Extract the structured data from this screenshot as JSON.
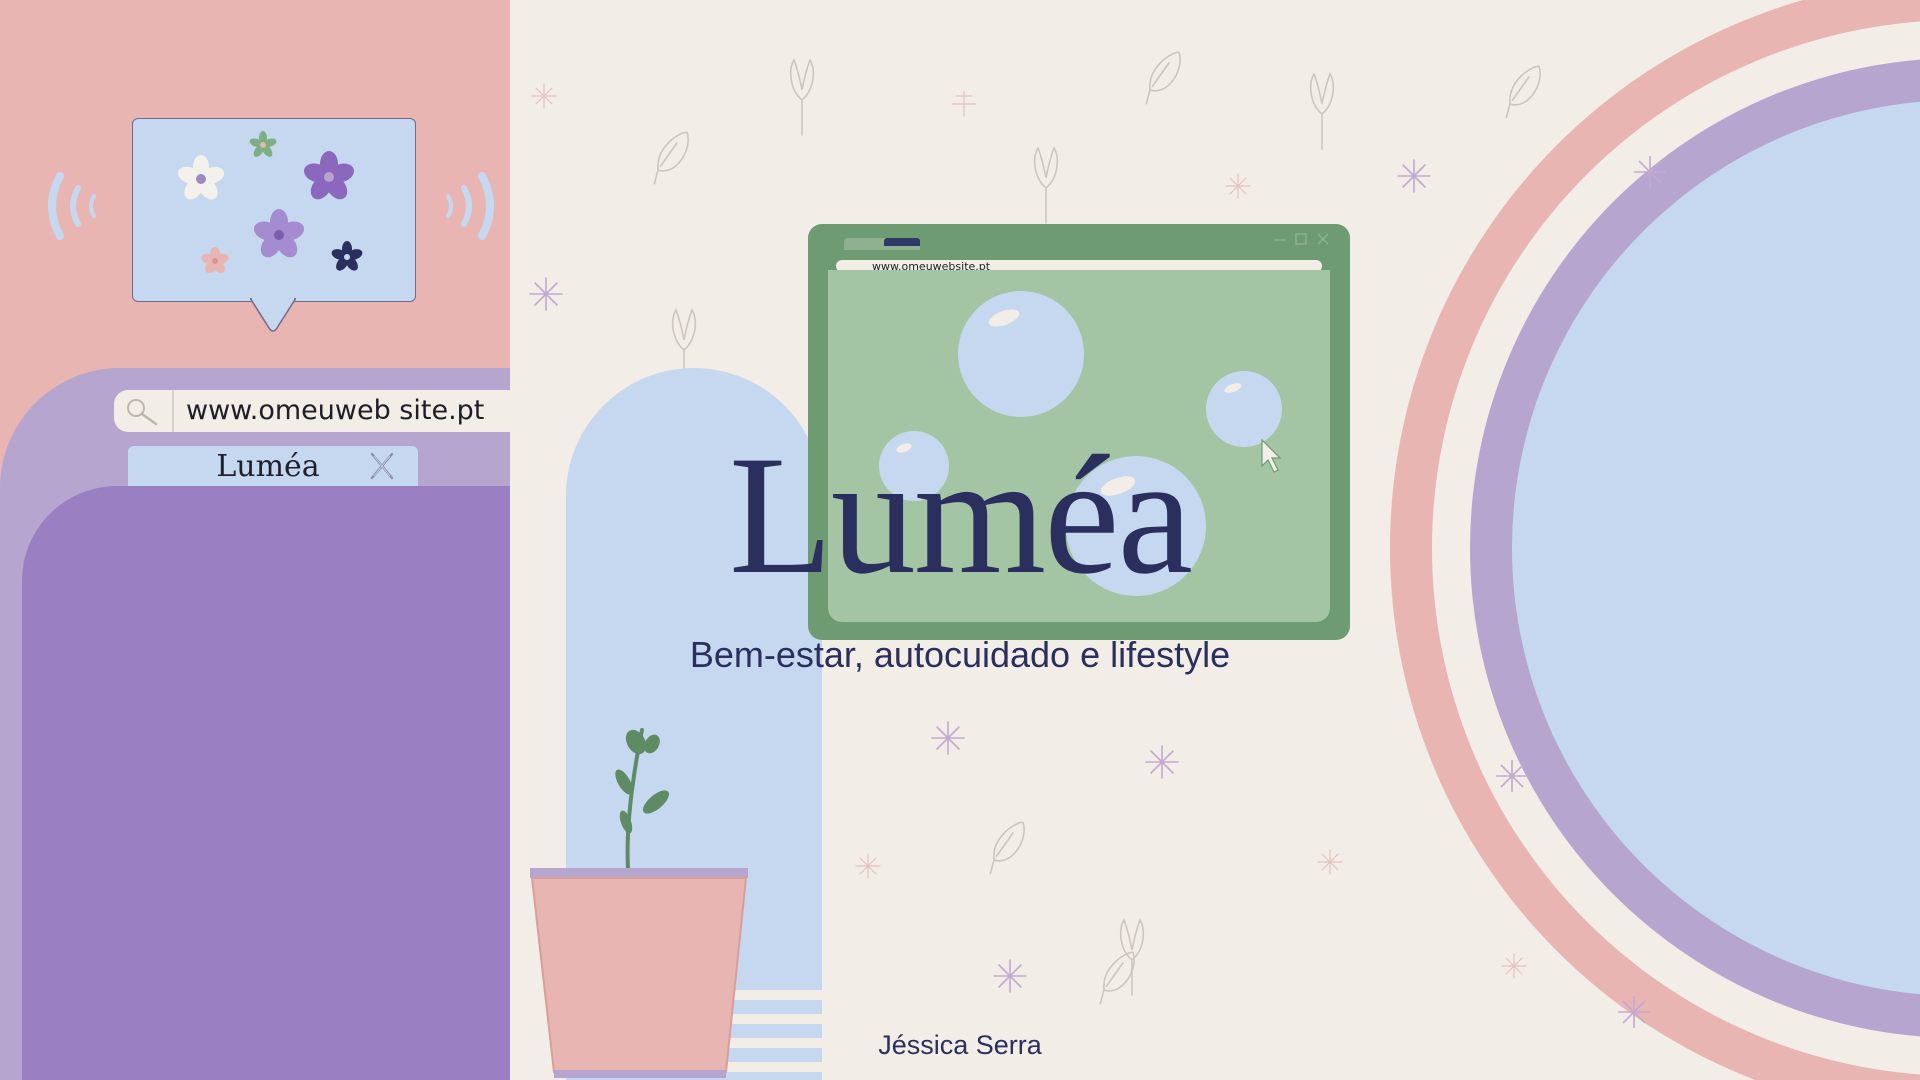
{
  "browser_bar": {
    "url": "www.omeuweb site.pt",
    "search_icon": "search-icon"
  },
  "browser_tab": {
    "label": "Luméa",
    "close_icon": "close-icon"
  },
  "window": {
    "url": "www.omeuwebsite.pt"
  },
  "hero": {
    "title": "Luméa",
    "tagline": "Bem-estar, autocuidado e lifestyle",
    "author": "Jéssica Serra"
  },
  "colors": {
    "background": "#f2ede6",
    "pink": "#e8b5b3",
    "lavender": "#b6a5cf",
    "purple": "#9a80c3",
    "light_blue": "#c6d8f0",
    "green": "#6e9b72",
    "light_green": "#a3c5a4",
    "navy": "#2b2f5e"
  }
}
